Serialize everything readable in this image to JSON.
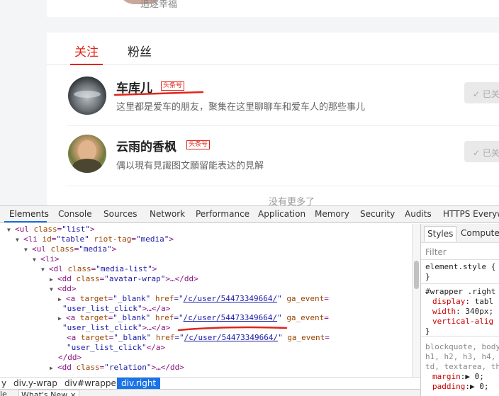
{
  "page": {
    "top_motto": "追逐幸福",
    "tabs": [
      {
        "label": "关注",
        "active": true
      },
      {
        "label": "粉丝",
        "active": false
      }
    ],
    "users": [
      {
        "name": "车库儿",
        "badge": "头条号",
        "desc": "这里都是爱车的朋友，聚集在这里聊聊车和爱车人的那些事儿",
        "button": "✓ 已关"
      },
      {
        "name": "云雨的香枫",
        "badge": "头条号",
        "desc": "偶以現有見識图文願留能表达的見解",
        "button": "✓ 已关"
      }
    ],
    "no_more": "没有更多了",
    "accent_color": "#e1251b"
  },
  "devtools": {
    "tabs": [
      "Elements",
      "Console",
      "Sources",
      "Network",
      "Performance",
      "Application",
      "Memory",
      "Security",
      "Audits",
      "HTTPS Everyw"
    ],
    "active_tab": "Elements",
    "tree": {
      "l1": {
        "tag": "<ul",
        "attr": "class",
        "val": "\"list\"",
        "end": ">"
      },
      "l2": {
        "tag": "<li",
        "a1": "id",
        "v1": "\"table\"",
        "a2": "riot-tag",
        "v2": "\"media\"",
        "end": ">"
      },
      "l3": {
        "tag": "<ul",
        "attr": "class",
        "val": "\"media\"",
        "end": ">"
      },
      "l4": {
        "tag": "<li>"
      },
      "l5": {
        "tag": "<dl",
        "attr": "class",
        "val": "\"media-list\"",
        "end": ">"
      },
      "l6": {
        "tag": "<dd",
        "attr": "class",
        "val": "\"avatar-wrap\"",
        "end": ">…</dd>"
      },
      "l7": {
        "tag": "<dd>"
      },
      "a_open": "<a",
      "a_target": "target",
      "a_target_v": "\"_blank\"",
      "a_href": "href",
      "a_href_q1": "=\"",
      "a_href_link": "/c/user/54473349664/",
      "a_href_q2": "\"",
      "a_ga": "ga_event",
      "a_ga_v": "\"user_list_click\"",
      "a_close_collapsed": ">…</a>",
      "a_close_inline": "</a>",
      "l_dd_close": "</dd>",
      "l_relation": {
        "tag": "<dd",
        "attr": "class",
        "val": "\"relation\"",
        "end": ">…</dd>"
      }
    },
    "styles": {
      "tabs": [
        "Styles",
        "Computed"
      ],
      "filter": "Filter",
      "element_style": "element.style {",
      "close_brace": "}",
      "rule_selector": "#wrapper .right",
      "rule_props": [
        {
          "prop": "display",
          "val": ": tabl"
        },
        {
          "prop": "width",
          "val": ": 340px;"
        },
        {
          "prop": "vertical-alig",
          "val": ""
        }
      ],
      "ua_selector_1": "blockquote, body",
      "ua_selector_2": "h1, h2, h3, h4,",
      "ua_selector_3": "td, textarea, th",
      "ua_props": [
        {
          "prop": "margin",
          "val": ":▶ 0;"
        },
        {
          "prop": "padding",
          "val": ":▶ 0;"
        }
      ]
    },
    "breadcrumb": [
      "y",
      "div.y-wrap",
      "div#wrapper",
      "div.right"
    ],
    "drawer_tabs": [
      "le",
      "What's New ×"
    ]
  }
}
